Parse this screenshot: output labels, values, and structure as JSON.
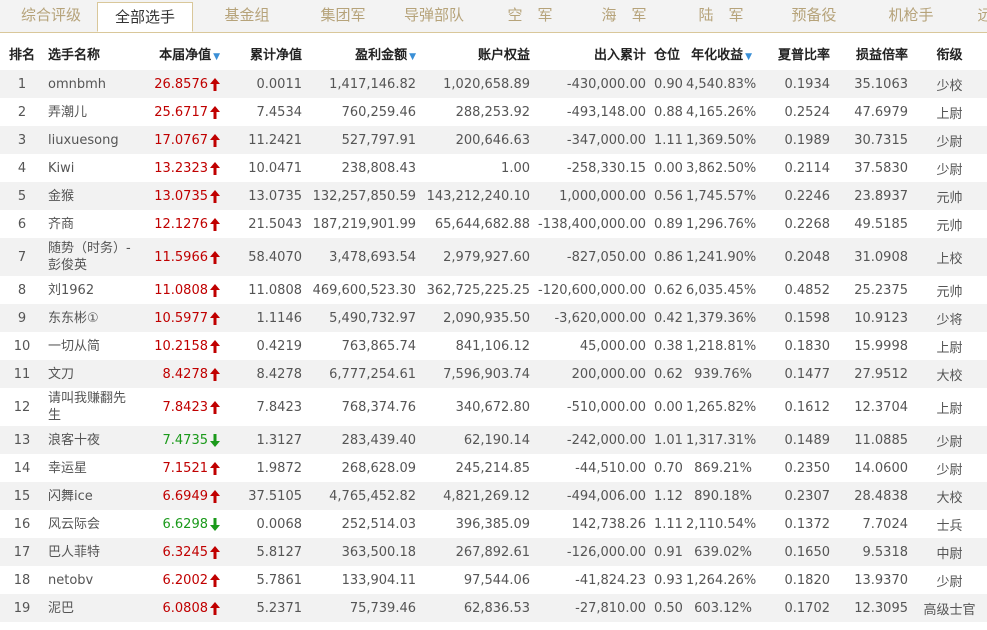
{
  "tabs": [
    {
      "label": "综合评级",
      "active": false
    },
    {
      "label": "全部选手",
      "active": true
    },
    {
      "label": "基金组",
      "active": false
    },
    {
      "label": "集团军",
      "active": false
    },
    {
      "label": "导弹部队",
      "active": false
    },
    {
      "label": "空　军",
      "active": false
    },
    {
      "label": "海　军",
      "active": false
    },
    {
      "label": "陆　军",
      "active": false
    },
    {
      "label": "预备役",
      "active": false
    },
    {
      "label": "机枪手",
      "active": false
    },
    {
      "label": "远",
      "active": false
    }
  ],
  "columns": {
    "rank": "排名",
    "name": "选手名称",
    "nav": "本届净值",
    "cum": "累计净值",
    "profit": "盈利金额",
    "equity": "账户权益",
    "flow": "出入累计",
    "pos": "仓位",
    "annual": "年化收益",
    "sharpe": "夏普比率",
    "ratio": "损益倍率",
    "grade": "衔级"
  },
  "sort_icon": "▼",
  "colors": {
    "up": "#c00000",
    "down": "#1b9a1b",
    "sort": "#3a8fd6"
  },
  "rows": [
    {
      "rank": "1",
      "name": "omnbmh",
      "nav": "26.8576",
      "trend": "up",
      "cum": "0.0011",
      "profit": "1,417,146.82",
      "equity": "1,020,658.89",
      "flow": "-430,000.00",
      "pos": "0.90",
      "annual": "4,540.83%",
      "sharpe": "0.1934",
      "ratio": "35.1063",
      "grade": "少校"
    },
    {
      "rank": "2",
      "name": "弄潮儿",
      "nav": "25.6717",
      "trend": "up",
      "cum": "7.4534",
      "profit": "760,259.46",
      "equity": "288,253.92",
      "flow": "-493,148.00",
      "pos": "0.88",
      "annual": "4,165.26%",
      "sharpe": "0.2524",
      "ratio": "47.6979",
      "grade": "上尉"
    },
    {
      "rank": "3",
      "name": "liuxuesong",
      "nav": "17.0767",
      "trend": "up",
      "cum": "11.2421",
      "profit": "527,797.91",
      "equity": "200,646.63",
      "flow": "-347,000.00",
      "pos": "1.11",
      "annual": "1,369.50%",
      "sharpe": "0.1989",
      "ratio": "30.7315",
      "grade": "少尉"
    },
    {
      "rank": "4",
      "name": "Kiwi",
      "nav": "13.2323",
      "trend": "up",
      "cum": "10.0471",
      "profit": "238,808.43",
      "equity": "1.00",
      "flow": "-258,330.15",
      "pos": "0.00",
      "annual": "3,862.50%",
      "sharpe": "0.2114",
      "ratio": "37.5830",
      "grade": "少尉"
    },
    {
      "rank": "5",
      "name": "金猴",
      "nav": "13.0735",
      "trend": "up",
      "cum": "13.0735",
      "profit": "132,257,850.59",
      "equity": "143,212,240.10",
      "flow": "1,000,000.00",
      "pos": "0.56",
      "annual": "1,745.57%",
      "sharpe": "0.2246",
      "ratio": "23.8937",
      "grade": "元帅"
    },
    {
      "rank": "6",
      "name": "齐商",
      "nav": "12.1276",
      "trend": "up",
      "cum": "21.5043",
      "profit": "187,219,901.99",
      "equity": "65,644,682.88",
      "flow": "-138,400,000.00",
      "pos": "0.89",
      "annual": "1,296.76%",
      "sharpe": "0.2268",
      "ratio": "49.5185",
      "grade": "元帅"
    },
    {
      "rank": "7",
      "name": "随势（时务）-彭俊英",
      "nav": "11.5966",
      "trend": "up",
      "cum": "58.4070",
      "profit": "3,478,693.54",
      "equity": "2,979,927.60",
      "flow": "-827,050.00",
      "pos": "0.86",
      "annual": "1,241.90%",
      "sharpe": "0.2048",
      "ratio": "31.0908",
      "grade": "上校"
    },
    {
      "rank": "8",
      "name": "刘1962",
      "nav": "11.0808",
      "trend": "up",
      "cum": "11.0808",
      "profit": "469,600,523.30",
      "equity": "362,725,225.25",
      "flow": "-120,600,000.00",
      "pos": "0.62",
      "annual": "6,035.45%",
      "sharpe": "0.4852",
      "ratio": "25.2375",
      "grade": "元帅"
    },
    {
      "rank": "9",
      "name": "东东彬①",
      "nav": "10.5977",
      "trend": "up",
      "cum": "1.1146",
      "profit": "5,490,732.97",
      "equity": "2,090,935.50",
      "flow": "-3,620,000.00",
      "pos": "0.42",
      "annual": "1,379.36%",
      "sharpe": "0.1598",
      "ratio": "10.9123",
      "grade": "少将"
    },
    {
      "rank": "10",
      "name": "一切从简",
      "nav": "10.2158",
      "trend": "up",
      "cum": "0.4219",
      "profit": "763,865.74",
      "equity": "841,106.12",
      "flow": "45,000.00",
      "pos": "0.38",
      "annual": "1,218.81%",
      "sharpe": "0.1830",
      "ratio": "15.9998",
      "grade": "上尉"
    },
    {
      "rank": "11",
      "name": "文刀",
      "nav": "8.4278",
      "trend": "up",
      "cum": "8.4278",
      "profit": "6,777,254.61",
      "equity": "7,596,903.74",
      "flow": "200,000.00",
      "pos": "0.62",
      "annual": "939.76%",
      "sharpe": "0.1477",
      "ratio": "27.9512",
      "grade": "大校"
    },
    {
      "rank": "12",
      "name": "请叫我赚翻先生",
      "nav": "7.8423",
      "trend": "up",
      "cum": "7.8423",
      "profit": "768,374.76",
      "equity": "340,672.80",
      "flow": "-510,000.00",
      "pos": "0.00",
      "annual": "1,265.82%",
      "sharpe": "0.1612",
      "ratio": "12.3704",
      "grade": "上尉"
    },
    {
      "rank": "13",
      "name": "浪客十夜",
      "nav": "7.4735",
      "trend": "down",
      "cum": "1.3127",
      "profit": "283,439.40",
      "equity": "62,190.14",
      "flow": "-242,000.00",
      "pos": "1.01",
      "annual": "1,317.31%",
      "sharpe": "0.1489",
      "ratio": "11.0885",
      "grade": "少尉"
    },
    {
      "rank": "14",
      "name": "幸运星",
      "nav": "7.1521",
      "trend": "up",
      "cum": "1.9872",
      "profit": "268,628.09",
      "equity": "245,214.85",
      "flow": "-44,510.00",
      "pos": "0.70",
      "annual": "869.21%",
      "sharpe": "0.2350",
      "ratio": "14.0600",
      "grade": "少尉"
    },
    {
      "rank": "15",
      "name": "闪舞ice",
      "nav": "6.6949",
      "trend": "up",
      "cum": "37.5105",
      "profit": "4,765,452.82",
      "equity": "4,821,269.12",
      "flow": "-494,006.00",
      "pos": "1.12",
      "annual": "890.18%",
      "sharpe": "0.2307",
      "ratio": "28.4838",
      "grade": "大校"
    },
    {
      "rank": "16",
      "name": "风云际会",
      "nav": "6.6298",
      "trend": "down",
      "cum": "0.0068",
      "profit": "252,514.03",
      "equity": "396,385.09",
      "flow": "142,738.26",
      "pos": "1.11",
      "annual": "2,110.54%",
      "sharpe": "0.1372",
      "ratio": "7.7024",
      "grade": "士兵"
    },
    {
      "rank": "17",
      "name": "巴人菲特",
      "nav": "6.3245",
      "trend": "up",
      "cum": "5.8127",
      "profit": "363,500.18",
      "equity": "267,892.61",
      "flow": "-126,000.00",
      "pos": "0.91",
      "annual": "639.02%",
      "sharpe": "0.1650",
      "ratio": "9.5318",
      "grade": "中尉"
    },
    {
      "rank": "18",
      "name": "netobv",
      "nav": "6.2002",
      "trend": "up",
      "cum": "5.7861",
      "profit": "133,904.11",
      "equity": "97,544.06",
      "flow": "-41,824.23",
      "pos": "0.93",
      "annual": "1,264.26%",
      "sharpe": "0.1820",
      "ratio": "13.9370",
      "grade": "少尉"
    },
    {
      "rank": "19",
      "name": "泥巴",
      "nav": "6.0808",
      "trend": "up",
      "cum": "5.2371",
      "profit": "75,739.46",
      "equity": "62,836.53",
      "flow": "-27,810.00",
      "pos": "0.50",
      "annual": "603.12%",
      "sharpe": "0.1702",
      "ratio": "12.3095",
      "grade": "高级士官"
    }
  ]
}
